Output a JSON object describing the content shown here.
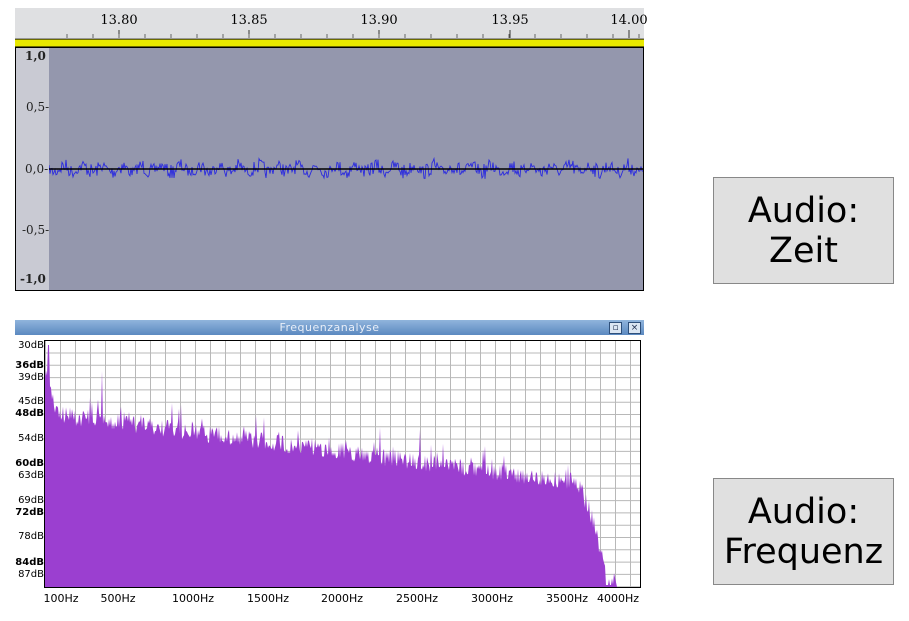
{
  "time_view": {
    "ruler_ticks": [
      "13.80",
      "13.85",
      "13.90",
      "13.95",
      "14.00"
    ],
    "amplitude_labels": [
      "1,0",
      "0,5-",
      "0,0-",
      "-0,5-",
      "-1,0"
    ],
    "colors": {
      "waveform": "#2a2adf",
      "track_bg": "#9497ad",
      "selection_bar": "#e8e800"
    }
  },
  "frequency_view": {
    "window_title": "Frequenzanalyse",
    "window_buttons": [
      "maximize",
      "close"
    ],
    "db_labels": [
      "30dB",
      "36dB",
      "39dB",
      "45dB",
      "48dB",
      "54dB",
      "60dB",
      "63dB",
      "69dB",
      "72dB",
      "78dB",
      "84dB",
      "87dB"
    ],
    "hz_labels": [
      "100Hz",
      "500Hz",
      "1000Hz",
      "1500Hz",
      "2000Hz",
      "2500Hz",
      "3000Hz",
      "3500Hz",
      "4000Hz"
    ],
    "colors": {
      "spectrum": "#9b3fd0",
      "grid": "#b8b8b8"
    }
  },
  "labels": {
    "time_label": "Audio:\nZeit",
    "frequency_label": "Audio:\nFrequenz"
  }
}
